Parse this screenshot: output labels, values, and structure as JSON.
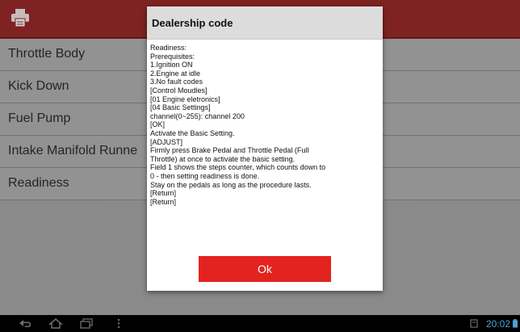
{
  "dialog": {
    "title": "Dealership code",
    "lines": [
      "Readiness:",
      "Prerequisites:",
      "1.Ignition ON",
      "2.Engine at idle",
      "3.No fault codes",
      "[Control Moudles]",
      "[01  Engine eletronics]",
      "[04 Basic Settings]",
      "channel(0~255): channel 200",
      "[OK]",
      "Activate the Basic Setting.",
      "[ADJUST]",
      "Firmly press Brake Pedal and Throttle Pedal (Full",
      "Throttle) at once to activate the basic setting.",
      "Field 1 shows the steps counter, which counts down to",
      "0 - then setting readiness is done.",
      "Stay on the pedals as long as the procedure lasts.",
      "[Return]",
      "[Return]"
    ],
    "ok_label": "Ok"
  },
  "list": {
    "items": [
      "Throttle Body",
      "Kick Down",
      "Fuel Pump",
      "Intake Manifold Runne",
      "Readiness"
    ]
  },
  "status": {
    "clock": "20:02"
  },
  "icons": {
    "topbar": "printer-icon",
    "nav": [
      "back-icon",
      "home-icon",
      "recent-apps-icon",
      "menu-icon"
    ],
    "status": [
      "storage-icon",
      "battery-icon"
    ]
  },
  "colors": {
    "topbar": "#9b2a2a",
    "ok_button": "#e3231f",
    "clock": "#4aa3d8"
  }
}
